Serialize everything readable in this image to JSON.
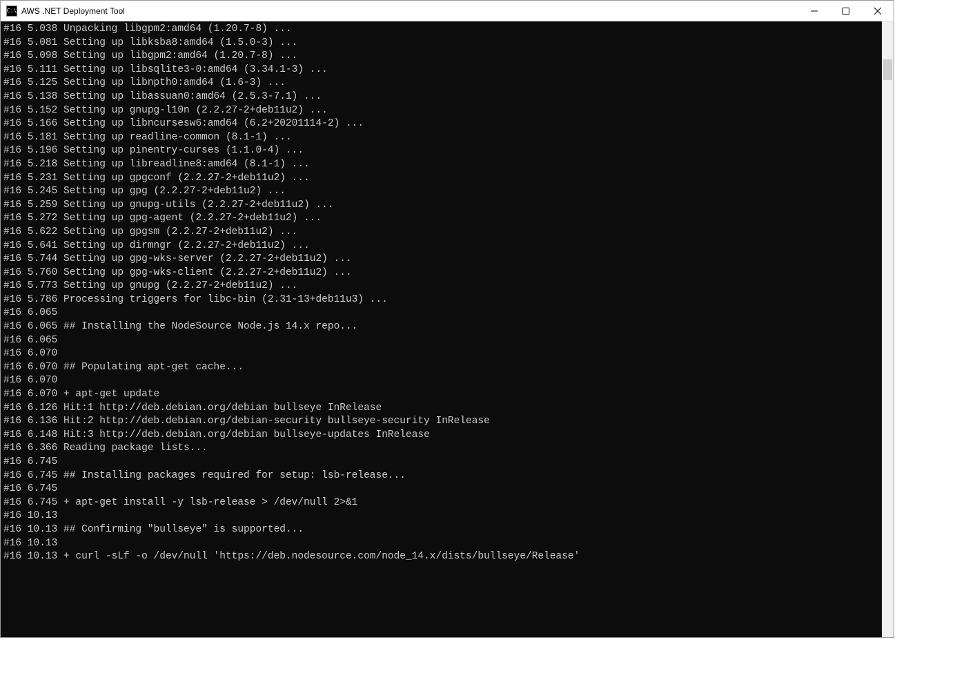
{
  "window": {
    "title": "AWS .NET Deployment Tool",
    "icon_text": "C:\\"
  },
  "console_lines": [
    "#16 5.038 Unpacking libgpm2:amd64 (1.20.7-8) ...",
    "#16 5.081 Setting up libksba8:amd64 (1.5.0-3) ...",
    "#16 5.098 Setting up libgpm2:amd64 (1.20.7-8) ...",
    "#16 5.111 Setting up libsqlite3-0:amd64 (3.34.1-3) ...",
    "#16 5.125 Setting up libnpth0:amd64 (1.6-3) ...",
    "#16 5.138 Setting up libassuan0:amd64 (2.5.3-7.1) ...",
    "#16 5.152 Setting up gnupg-l10n (2.2.27-2+deb11u2) ...",
    "#16 5.166 Setting up libncursesw6:amd64 (6.2+20201114-2) ...",
    "#16 5.181 Setting up readline-common (8.1-1) ...",
    "#16 5.196 Setting up pinentry-curses (1.1.0-4) ...",
    "#16 5.218 Setting up libreadline8:amd64 (8.1-1) ...",
    "#16 5.231 Setting up gpgconf (2.2.27-2+deb11u2) ...",
    "#16 5.245 Setting up gpg (2.2.27-2+deb11u2) ...",
    "#16 5.259 Setting up gnupg-utils (2.2.27-2+deb11u2) ...",
    "#16 5.272 Setting up gpg-agent (2.2.27-2+deb11u2) ...",
    "#16 5.622 Setting up gpgsm (2.2.27-2+deb11u2) ...",
    "#16 5.641 Setting up dirmngr (2.2.27-2+deb11u2) ...",
    "#16 5.744 Setting up gpg-wks-server (2.2.27-2+deb11u2) ...",
    "#16 5.760 Setting up gpg-wks-client (2.2.27-2+deb11u2) ...",
    "#16 5.773 Setting up gnupg (2.2.27-2+deb11u2) ...",
    "#16 5.786 Processing triggers for libc-bin (2.31-13+deb11u3) ...",
    "#16 6.065",
    "#16 6.065 ## Installing the NodeSource Node.js 14.x repo...",
    "#16 6.065",
    "#16 6.070",
    "#16 6.070 ## Populating apt-get cache...",
    "#16 6.070",
    "#16 6.070 + apt-get update",
    "#16 6.126 Hit:1 http://deb.debian.org/debian bullseye InRelease",
    "#16 6.136 Hit:2 http://deb.debian.org/debian-security bullseye-security InRelease",
    "#16 6.148 Hit:3 http://deb.debian.org/debian bullseye-updates InRelease",
    "#16 6.366 Reading package lists...",
    "#16 6.745",
    "#16 6.745 ## Installing packages required for setup: lsb-release...",
    "#16 6.745",
    "#16 6.745 + apt-get install -y lsb-release > /dev/null 2>&1",
    "#16 10.13",
    "#16 10.13 ## Confirming \"bullseye\" is supported...",
    "#16 10.13",
    "#16 10.13 + curl -sLf -o /dev/null 'https://deb.nodesource.com/node_14.x/dists/bullseye/Release'"
  ]
}
